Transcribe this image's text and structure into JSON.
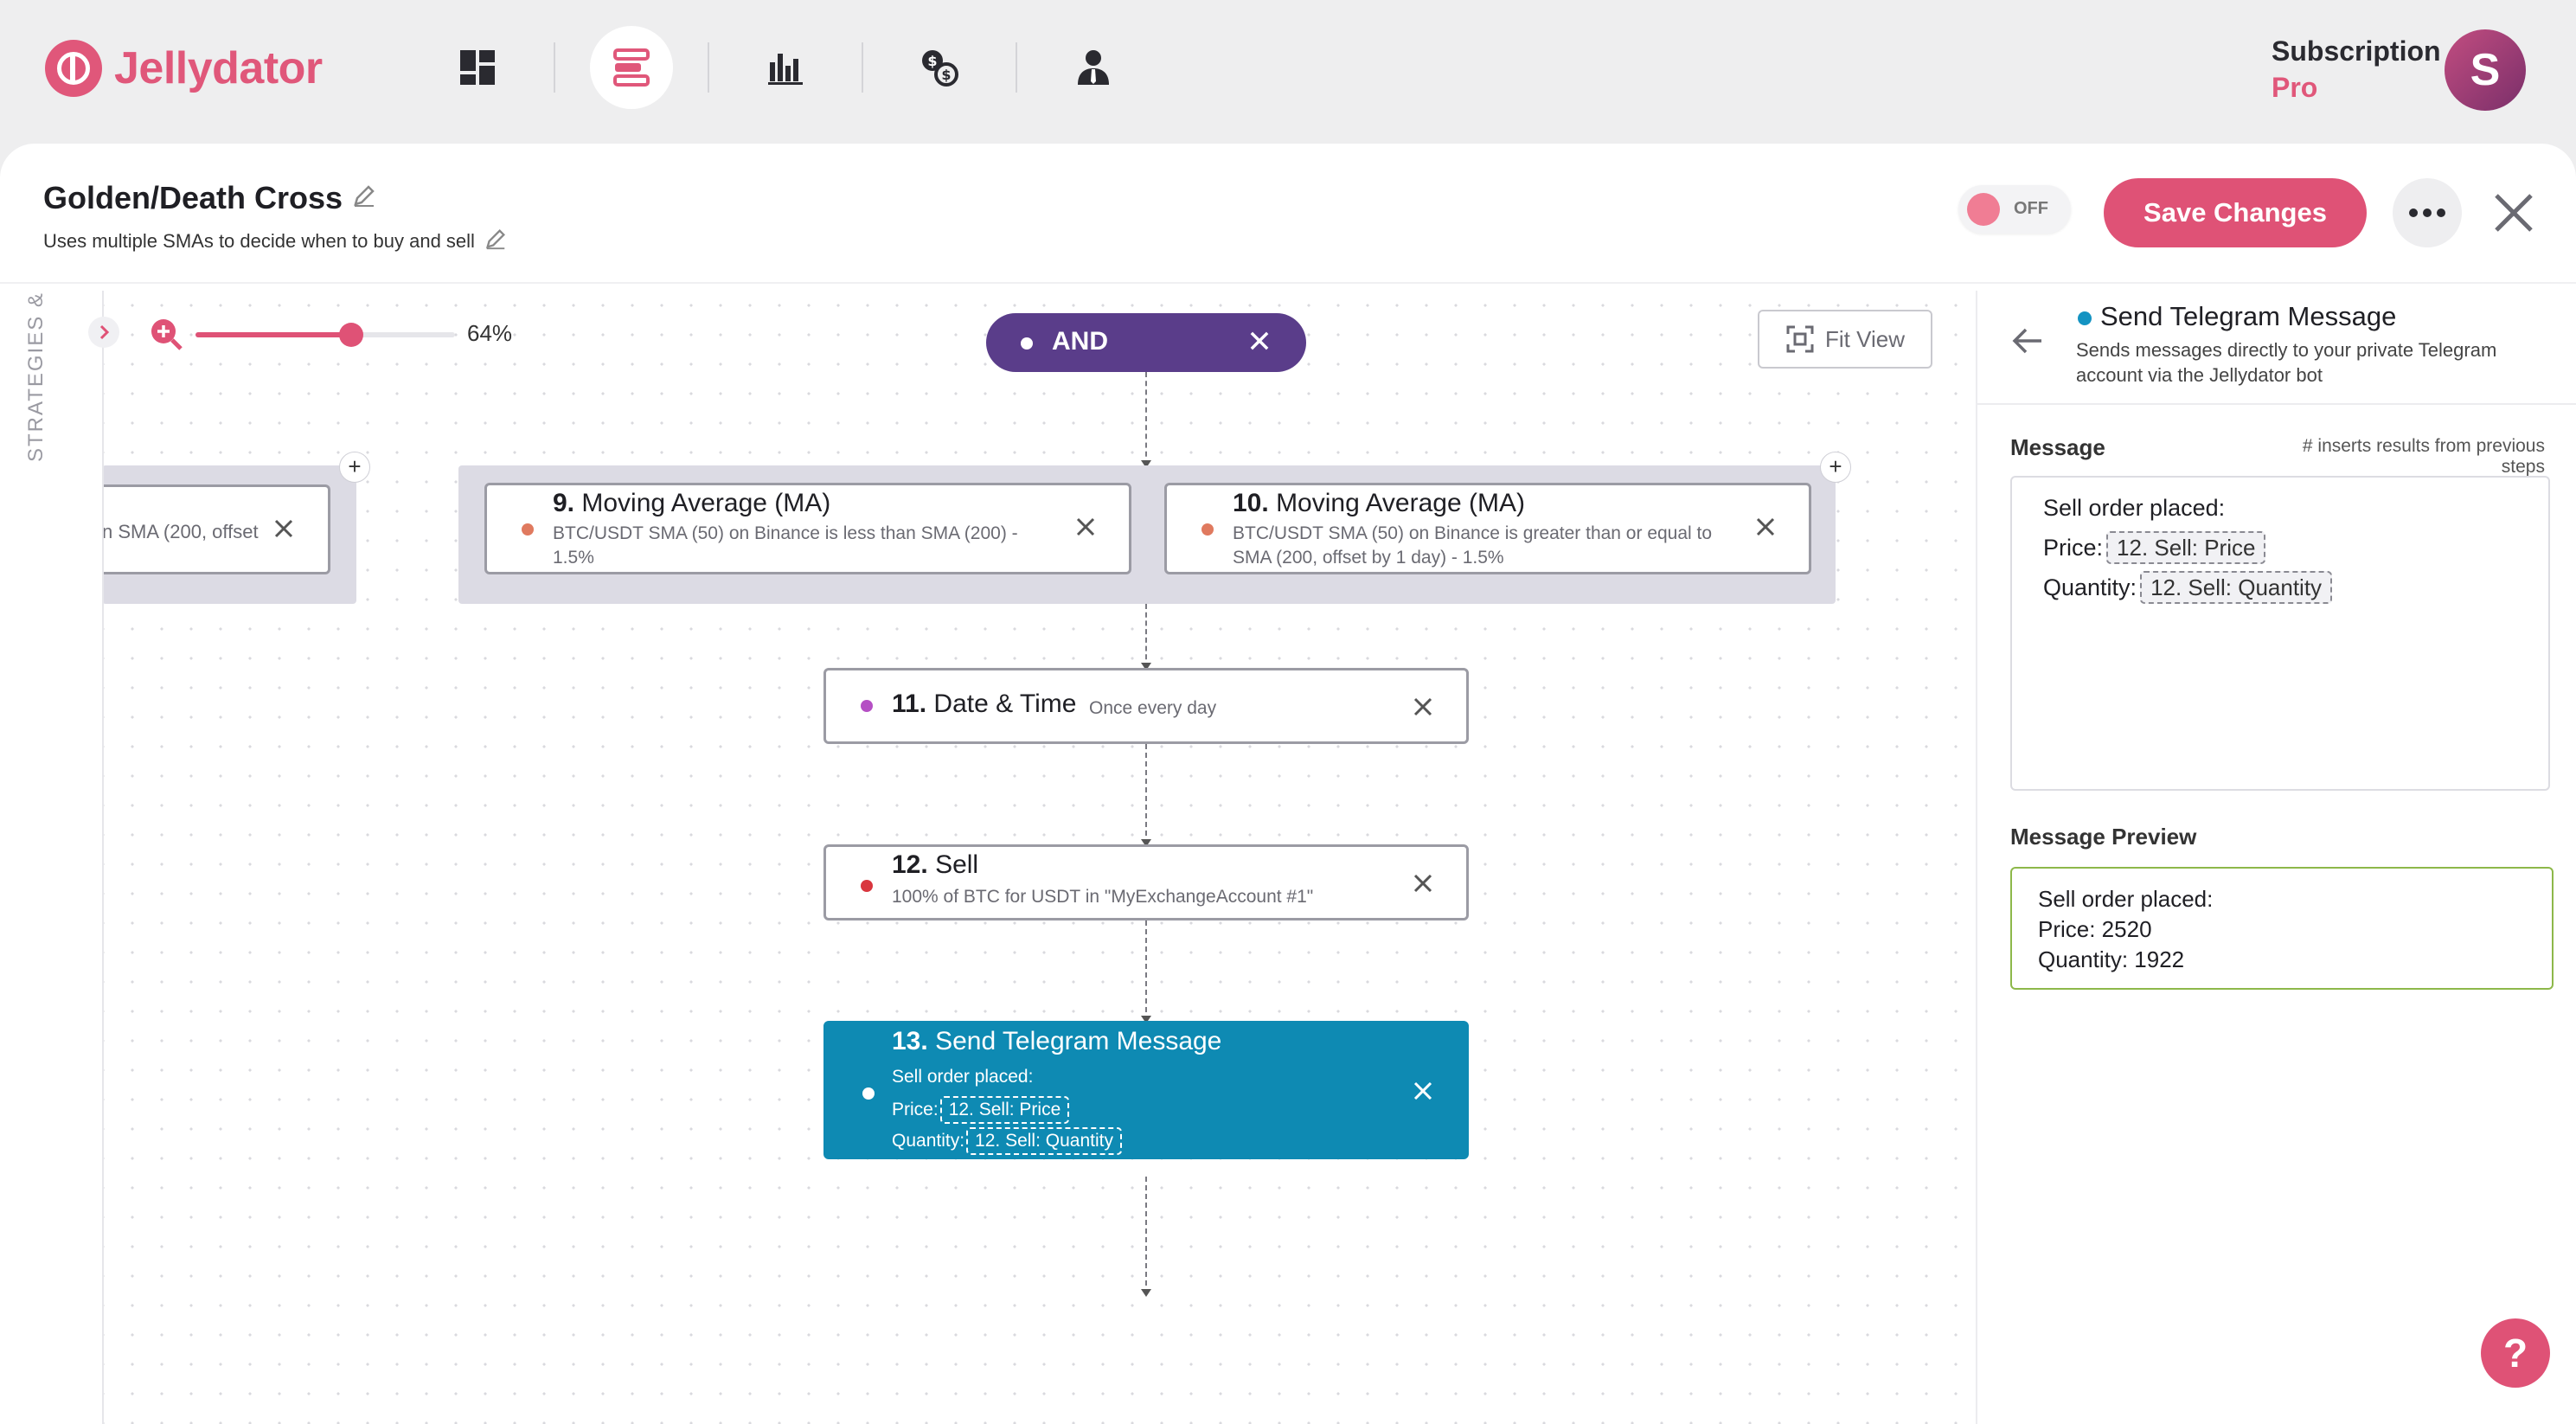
{
  "brand": {
    "name": "Jellydator",
    "accent": "#e0577a"
  },
  "topnav": {
    "icons": [
      "dashboard-icon",
      "strategies-icon",
      "stats-icon",
      "exchange-icon",
      "account-icon"
    ],
    "active": "strategies-icon",
    "subscription_label": "Subscription",
    "subscription_plan": "Pro",
    "avatar_initial": "S"
  },
  "strategy": {
    "title": "Golden/Death Cross",
    "description": "Uses multiple SMAs to decide when to buy and sell",
    "toggle_label": "OFF",
    "save_label": "Save Changes"
  },
  "canvas": {
    "side_label": "STRATEGIES & TEMPLATES",
    "zoom_label": "64%",
    "zoom_value": 0.64,
    "fit_view_label": "Fit View",
    "and_label": "AND",
    "partial_node_desc": "n SMA (200, offset",
    "nodes": [
      {
        "num": "9.",
        "title": "Moving Average (MA)",
        "desc": "BTC/USDT SMA (50) on Binance is less than SMA (200) - 1.5%",
        "dot": "#e07a5f"
      },
      {
        "num": "10.",
        "title": "Moving Average (MA)",
        "desc": "BTC/USDT SMA (50) on Binance is greater than or equal to SMA (200, offset by 1 day) - 1.5%",
        "dot": "#e07a5f"
      },
      {
        "num": "11.",
        "title": "Date & Time",
        "desc": "Once every day",
        "dot": "#b54fc4"
      },
      {
        "num": "12.",
        "title": "Sell",
        "desc": "100% of BTC for USDT in \"MyExchangeAccount #1\"",
        "dot": "#d9363e"
      },
      {
        "num": "13.",
        "title": "Send Telegram Message",
        "line1": "Sell order placed:",
        "price_label": "Price:",
        "price_chip": "12. Sell: Price",
        "qty_label": "Quantity:",
        "qty_chip": "12. Sell: Quantity"
      }
    ]
  },
  "panel": {
    "title": "Send Telegram Message",
    "description": "Sends messages directly to your private Telegram account via the Jellydator bot",
    "message_label": "Message",
    "message_hint": "# inserts results from previous steps",
    "message_line1": "Sell order placed:",
    "message_price_label": "Price:",
    "message_price_chip": "12. Sell: Price",
    "message_qty_label": "Quantity:",
    "message_qty_chip": "12. Sell: Quantity",
    "preview_label": "Message Preview",
    "preview_lines": [
      "Sell order placed:",
      "Price: 2520",
      "Quantity: 1922"
    ]
  },
  "help_label": "?"
}
